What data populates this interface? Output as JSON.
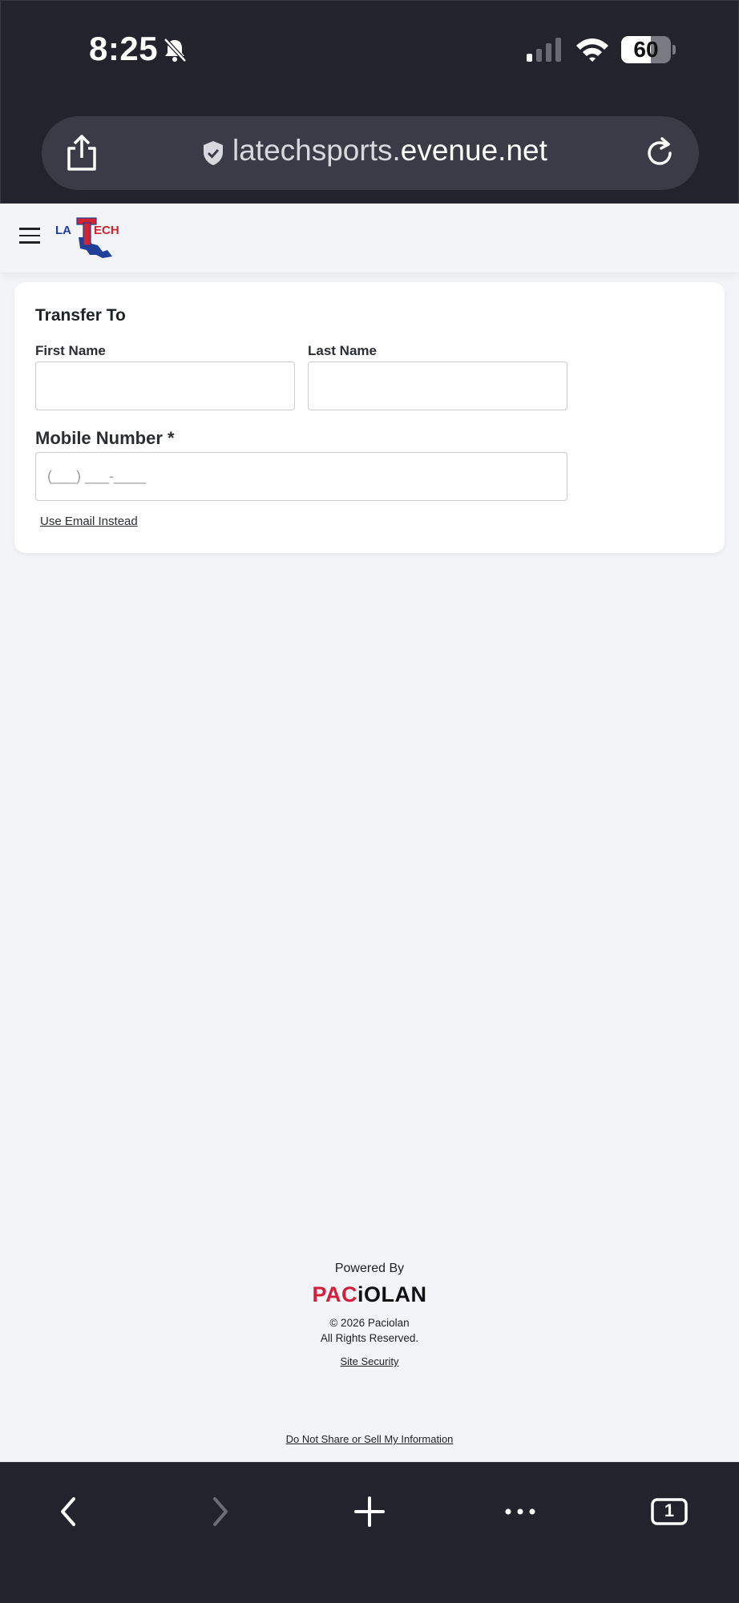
{
  "status_bar": {
    "time": "8:25",
    "icons": [
      "bell-slash-icon",
      "cellular-signal-icon",
      "wifi-icon"
    ],
    "battery_level": "60",
    "battery_fraction": 0.6
  },
  "browser": {
    "url_prefix": "latechsports.",
    "url_host": "evenue.net",
    "toolbar_icons": [
      "share-icon",
      "shield-icon",
      "reload-icon"
    ]
  },
  "header": {
    "logo_text": "LA TECH",
    "menu_icon": "hamburger-menu-icon"
  },
  "form": {
    "title": "Transfer To",
    "first_name_label": "First Name",
    "first_name_value": "",
    "last_name_label": "Last Name",
    "last_name_value": "",
    "mobile_label": "Mobile Number *",
    "mobile_placeholder": "(___) ___-____",
    "mobile_value": "",
    "alt_link": "Use Email Instead"
  },
  "footer": {
    "powered_by": "Powered By",
    "brand_red": "PAC",
    "brand_dark": "iOLAN",
    "copyright_line1": "© 2026 Paciolan",
    "copyright_line2": "All Rights Reserved.",
    "site_security": "Site Security",
    "do_not_sell": "Do Not Share or Sell My Information"
  },
  "bottom_toolbar": {
    "icons": [
      "back-icon",
      "forward-icon",
      "new-tab-icon",
      "more-icon",
      "tabs-icon"
    ],
    "tab_count": "1"
  },
  "colors": {
    "chrome_bg": "#23232e",
    "page_bg": "#f3f4f8",
    "brand_red": "#d21f3c",
    "tech_blue": "#1f3f99",
    "tech_red": "#d5232f"
  }
}
